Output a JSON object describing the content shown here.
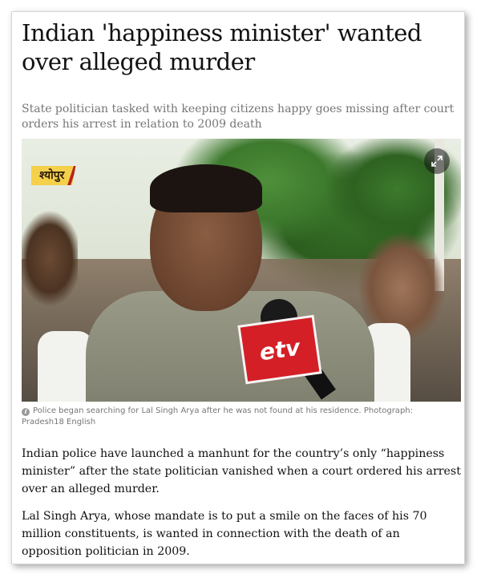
{
  "article": {
    "headline": "Indian 'happiness minister' wanted over alleged murder",
    "standfirst": "State politician tasked with keeping citizens happy goes missing after court orders his arrest in relation to 2009 death",
    "photo": {
      "location_tag": "श्योपुर",
      "mic_logo": "etv",
      "expand_icon": "expand-arrows-icon"
    },
    "caption": "Police began searching for Lal Singh Arya after he was not found at his residence. Photograph: Pradesh18 English",
    "caption_icon": "i",
    "paragraphs": [
      "Indian police have launched a manhunt for the country’s only “happiness minister” after the state politician vanished when a court ordered his arrest over an alleged murder.",
      "Lal Singh Arya, whose mandate is to put a smile on the faces of his 70 million constituents, is wanted in connection with the death of an opposition politician in 2009."
    ]
  },
  "colors": {
    "headline": "#121212",
    "standfirst": "#767676",
    "caption": "#767676",
    "location_tag_bg": "#f5d04a",
    "mic_red": "#d41f26"
  }
}
